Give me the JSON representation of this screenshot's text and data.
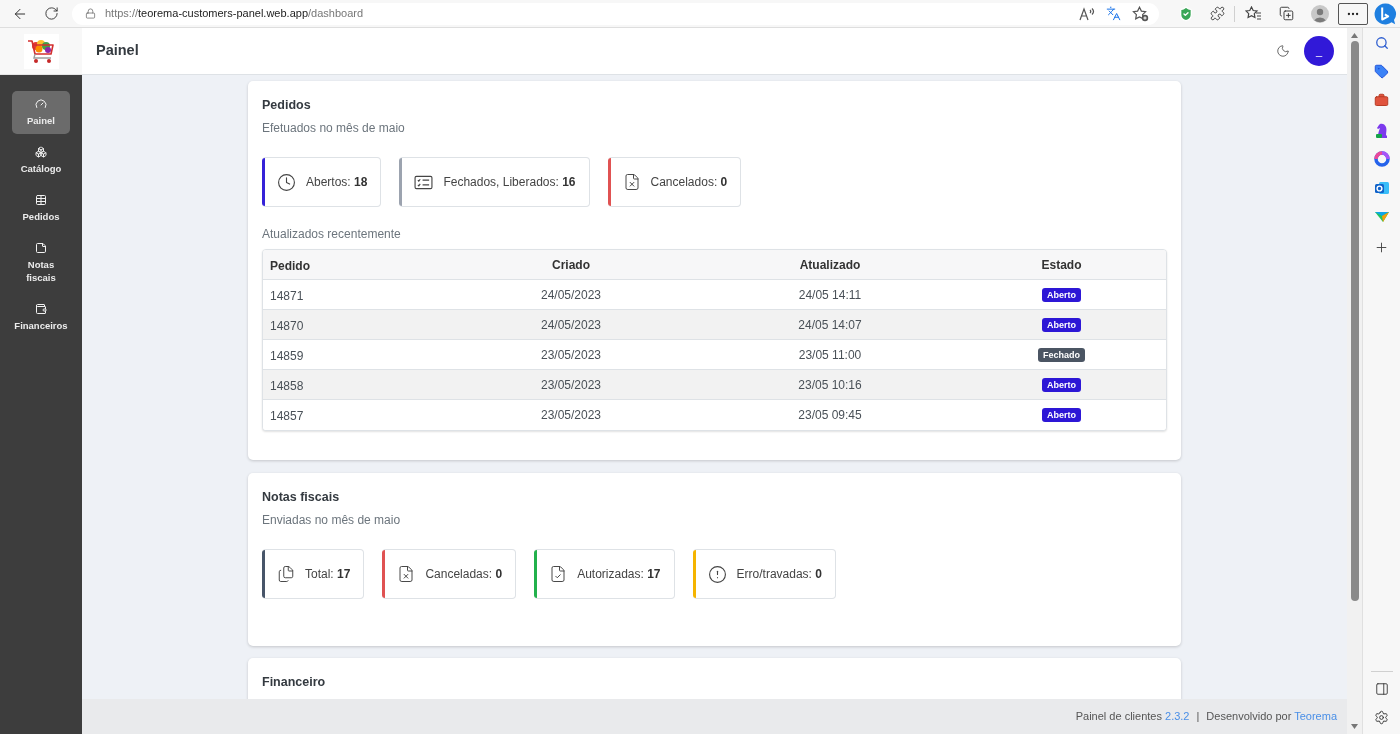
{
  "browser": {
    "url": {
      "scheme": "https://",
      "host": "teorema-customers-panel.web.app",
      "path": "/dashboard"
    }
  },
  "header": {
    "title": "Painel",
    "avatar": "_"
  },
  "sidebar": {
    "items": [
      {
        "label": "Painel",
        "selected": true
      },
      {
        "label": "Catálogo",
        "selected": false
      },
      {
        "label": "Pedidos",
        "selected": false
      },
      {
        "label": "Notas fiscais",
        "selected": false
      },
      {
        "label": "Financeiros",
        "selected": false
      }
    ]
  },
  "sections": [
    {
      "title": "Pedidos",
      "subtitle": "Efetuados no mês de maio",
      "stats": [
        {
          "label": "Abertos:",
          "value": "18",
          "color": "#3522d8"
        },
        {
          "label": "Fechados, Liberados:",
          "value": "16",
          "color": "#9ca3af"
        },
        {
          "label": "Cancelados:",
          "value": "0",
          "color": "#e05252"
        }
      ],
      "table_title": "Atualizados recentemente",
      "table": {
        "columns": [
          "Pedido",
          "Criado",
          "Atualizado",
          "Estado"
        ],
        "rows": [
          {
            "pedido": "14871",
            "criado": "24/05/2023",
            "atualizado": "24/05 14:11",
            "estado": {
              "label": "Aberto",
              "color": "#2d17d6"
            }
          },
          {
            "pedido": "14870",
            "criado": "24/05/2023",
            "atualizado": "24/05 14:07",
            "estado": {
              "label": "Aberto",
              "color": "#2d17d6"
            }
          },
          {
            "pedido": "14859",
            "criado": "23/05/2023",
            "atualizado": "23/05 11:00",
            "estado": {
              "label": "Fechado",
              "color": "#4b5563"
            }
          },
          {
            "pedido": "14858",
            "criado": "23/05/2023",
            "atualizado": "23/05 10:16",
            "estado": {
              "label": "Aberto",
              "color": "#2d17d6"
            }
          },
          {
            "pedido": "14857",
            "criado": "23/05/2023",
            "atualizado": "23/05 09:45",
            "estado": {
              "label": "Aberto",
              "color": "#2d17d6"
            }
          }
        ]
      }
    },
    {
      "title": "Notas fiscais",
      "subtitle": "Enviadas no mês de maio",
      "stats": [
        {
          "label": "Total:",
          "value": "17",
          "color": "#475569"
        },
        {
          "label": "Canceladas:",
          "value": "0",
          "color": "#e05252"
        },
        {
          "label": "Autorizadas:",
          "value": "17",
          "color": "#22b14c"
        },
        {
          "label": "Erro/travadas:",
          "value": "0",
          "color": "#f5b400"
        }
      ]
    },
    {
      "title": "Financeiro"
    }
  ],
  "footer": {
    "app_name": "Painel de clientes",
    "version": "2.3.2",
    "separator": "|",
    "credit": "Desenvolvido por",
    "company": "Teorema"
  }
}
